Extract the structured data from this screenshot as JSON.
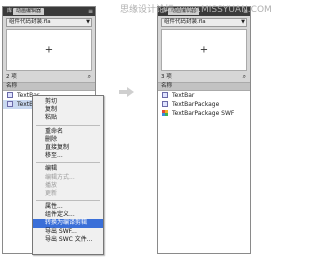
{
  "watermark": "思缘设计论坛 www.MISSYUAN.COM",
  "left_panel": {
    "tabs": [
      "库",
      "动画编辑器"
    ],
    "library_select": "组件代码封装.fla",
    "item_count": "2 项",
    "column_header": "名称",
    "items": [
      {
        "label": "TextBar",
        "icon": "symbol-icon",
        "selected": false
      },
      {
        "label": "TextBarPackage",
        "icon": "symbol-icon",
        "selected": true
      }
    ]
  },
  "right_panel": {
    "tabs": [
      "库",
      "动画编辑器"
    ],
    "library_select": "组件代码封装.fla",
    "item_count": "3 项",
    "column_header": "名称",
    "items": [
      {
        "label": "TextBar",
        "icon": "symbol-icon",
        "selected": false
      },
      {
        "label": "TextBarPackage",
        "icon": "symbol-icon",
        "selected": false
      },
      {
        "label": "TextBarPackage SWF",
        "icon": "swf-icon",
        "selected": false
      }
    ]
  },
  "context_menu": {
    "groups": [
      [
        {
          "label": "剪切"
        },
        {
          "label": "复制"
        },
        {
          "label": "粘贴"
        }
      ],
      [
        {
          "label": "重命名"
        },
        {
          "label": "删除"
        },
        {
          "label": "直接复制"
        },
        {
          "label": "移至..."
        }
      ],
      [
        {
          "label": "编辑"
        },
        {
          "label": "编辑方式...",
          "disabled": true
        },
        {
          "label": "播放",
          "disabled": true
        },
        {
          "label": "更新",
          "disabled": true
        }
      ],
      [
        {
          "label": "属性..."
        },
        {
          "label": "组件定义..."
        },
        {
          "label": "转换为编译剪辑",
          "highlight": true
        },
        {
          "label": "导出 SWF..."
        },
        {
          "label": "导出 SWC 文件..."
        }
      ]
    ]
  },
  "colors": {
    "highlight": "#3a6fd8",
    "selected_row": "#c8d8f0",
    "panel": "#d6d6d6"
  }
}
